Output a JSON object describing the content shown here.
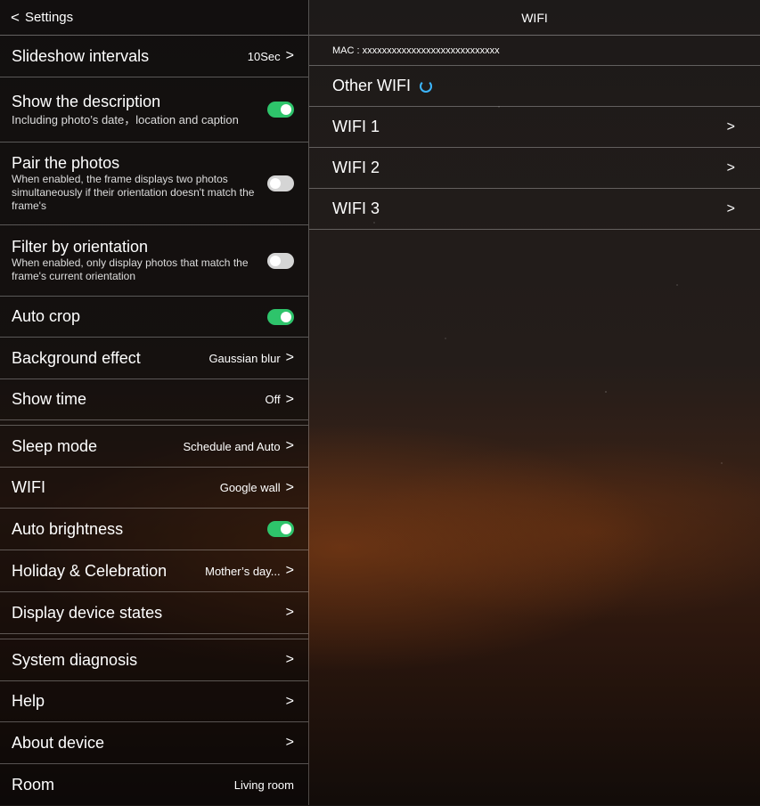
{
  "header": {
    "back_label": "Settings",
    "wifi_title": "WIFI"
  },
  "settings": {
    "slideshow": {
      "label": "Slideshow intervals",
      "value": "10Sec"
    },
    "show_description": {
      "label": "Show the description",
      "sub": "Including photo’s date，location and caption",
      "on": true
    },
    "pair_photos": {
      "label": "Pair the photos",
      "sub": "When enabled, the frame displays two photos simultaneously if their orientation doesn't match the frame's",
      "on": false
    },
    "filter_orientation": {
      "label": "Filter by orientation",
      "sub": "When enabled, only display photos that match the frame's current orientation",
      "on": false
    },
    "auto_crop": {
      "label": "Auto crop",
      "on": true
    },
    "background_effect": {
      "label": "Background effect",
      "value": "Gaussian blur"
    },
    "show_time": {
      "label": "Show time",
      "value": "Off"
    },
    "sleep_mode": {
      "label": "Sleep mode",
      "value": "Schedule and Auto"
    },
    "wifi": {
      "label": "WIFI",
      "value": "Google wall"
    },
    "auto_brightness": {
      "label": "Auto brightness",
      "on": true
    },
    "holiday": {
      "label": "Holiday & Celebration",
      "value": "Mother’s day..."
    },
    "display_states": {
      "label": "Display device states"
    },
    "system_diagnosis": {
      "label": "System diagnosis"
    },
    "help": {
      "label": "Help"
    },
    "about": {
      "label": "About device"
    },
    "room": {
      "label": "Room",
      "value": "Living room"
    }
  },
  "wifi_panel": {
    "mac": "MAC : xxxxxxxxxxxxxxxxxxxxxxxxxxxx",
    "other": "Other WIFI",
    "networks": [
      "WIFI 1",
      "WIFI 2",
      "WIFI 3"
    ]
  },
  "icons": {
    "chevron": ">",
    "back": "<"
  },
  "colors": {
    "toggle_on": "#2ec46b",
    "toggle_off": "#d5d5d5",
    "spinner": "#3cb6ff"
  }
}
